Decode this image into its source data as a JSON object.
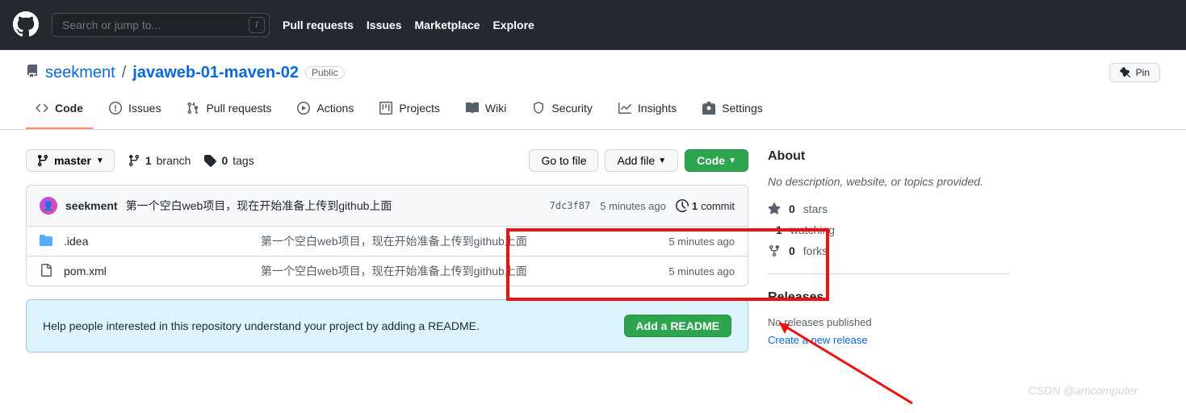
{
  "header": {
    "search_placeholder": "Search or jump to...",
    "nav": [
      "Pull requests",
      "Issues",
      "Marketplace",
      "Explore"
    ]
  },
  "repo": {
    "owner": "seekment",
    "name": "javaweb-01-maven-02",
    "visibility": "Public",
    "pin": "Pin"
  },
  "tabs": [
    {
      "label": "Code"
    },
    {
      "label": "Issues"
    },
    {
      "label": "Pull requests"
    },
    {
      "label": "Actions"
    },
    {
      "label": "Projects"
    },
    {
      "label": "Wiki"
    },
    {
      "label": "Security"
    },
    {
      "label": "Insights"
    },
    {
      "label": "Settings"
    }
  ],
  "branch": {
    "name": "master",
    "branches_count": "1",
    "branches_label": "branch",
    "tags_count": "0",
    "tags_label": "tags"
  },
  "actions": {
    "goto": "Go to file",
    "add": "Add file",
    "code": "Code"
  },
  "commit": {
    "author": "seekment",
    "message": "第一个空白web项目，现在开始准备上传到github上面",
    "sha": "7dc3f87",
    "time": "5 minutes ago",
    "count": "1",
    "count_label": "commit"
  },
  "files": [
    {
      "type": "dir",
      "name": ".idea",
      "msg": "第一个空白web项目，现在开始准备上传到github上面",
      "time": "5 minutes ago"
    },
    {
      "type": "file",
      "name": "pom.xml",
      "msg": "第一个空白web项目，现在开始准备上传到github上面",
      "time": "5 minutes ago"
    }
  ],
  "readme": {
    "text": "Help people interested in this repository understand your project by adding a README.",
    "button": "Add a README"
  },
  "about": {
    "title": "About",
    "desc": "No description, website, or topics provided.",
    "stars": "0",
    "stars_label": "stars",
    "watching": "1",
    "watching_label": "watching",
    "forks": "0",
    "forks_label": "forks"
  },
  "releases": {
    "title": "Releases",
    "none": "No releases published",
    "create": "Create a new release"
  },
  "watermark": "CSDN @amcomputer"
}
